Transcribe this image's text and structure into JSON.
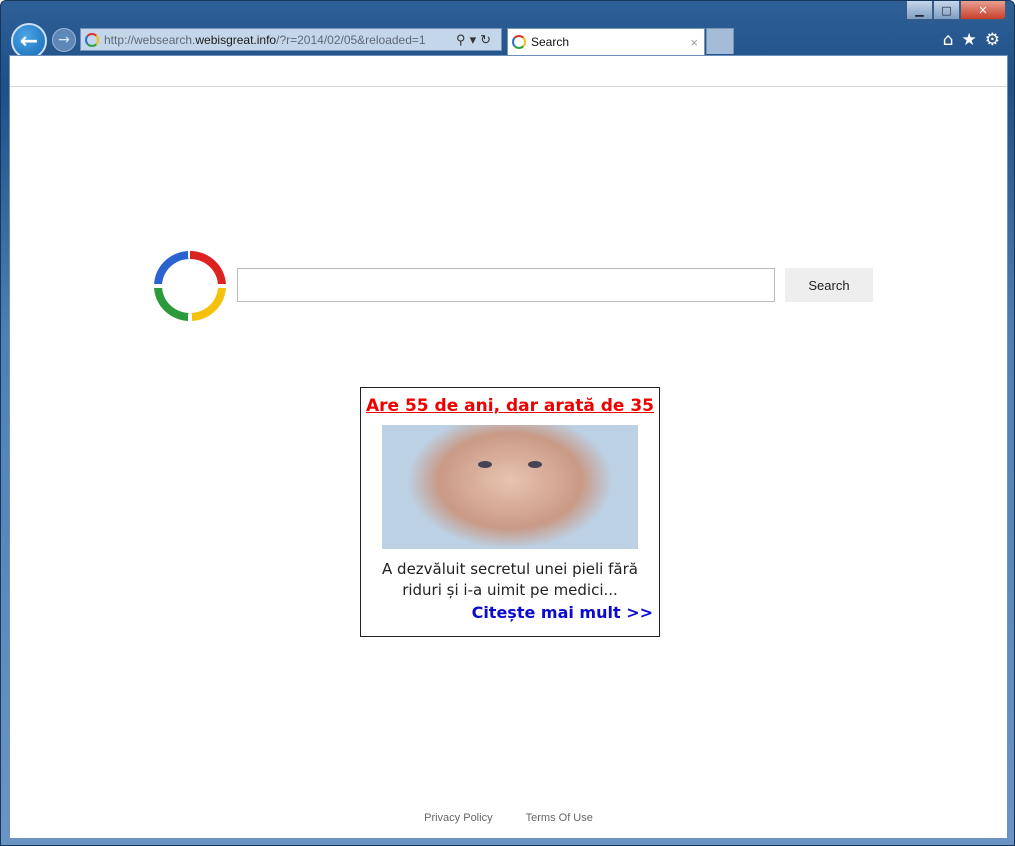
{
  "browser": {
    "address": {
      "prefix": "http://websearch.",
      "domain": "webisgreat.info",
      "suffix": "/?r=2014/02/05&reloaded=1"
    },
    "tab": {
      "title": "Search",
      "close": "×"
    },
    "window_buttons": {
      "minimize": "▁",
      "maximize": "□",
      "close": "✕"
    }
  },
  "search": {
    "button_label": "Search",
    "input_value": ""
  },
  "ad": {
    "title": "Are 55 de ani, dar arată de 35",
    "body": "A dezvăluit secretul unei pieli fără riduri și i-a uimit pe medici...",
    "cta": "Citește mai mult >>",
    "title_color": "#e00000",
    "cta_color": "#0a0ad0"
  },
  "footer": {
    "privacy": "Privacy Policy",
    "terms": "Terms Of Use"
  }
}
